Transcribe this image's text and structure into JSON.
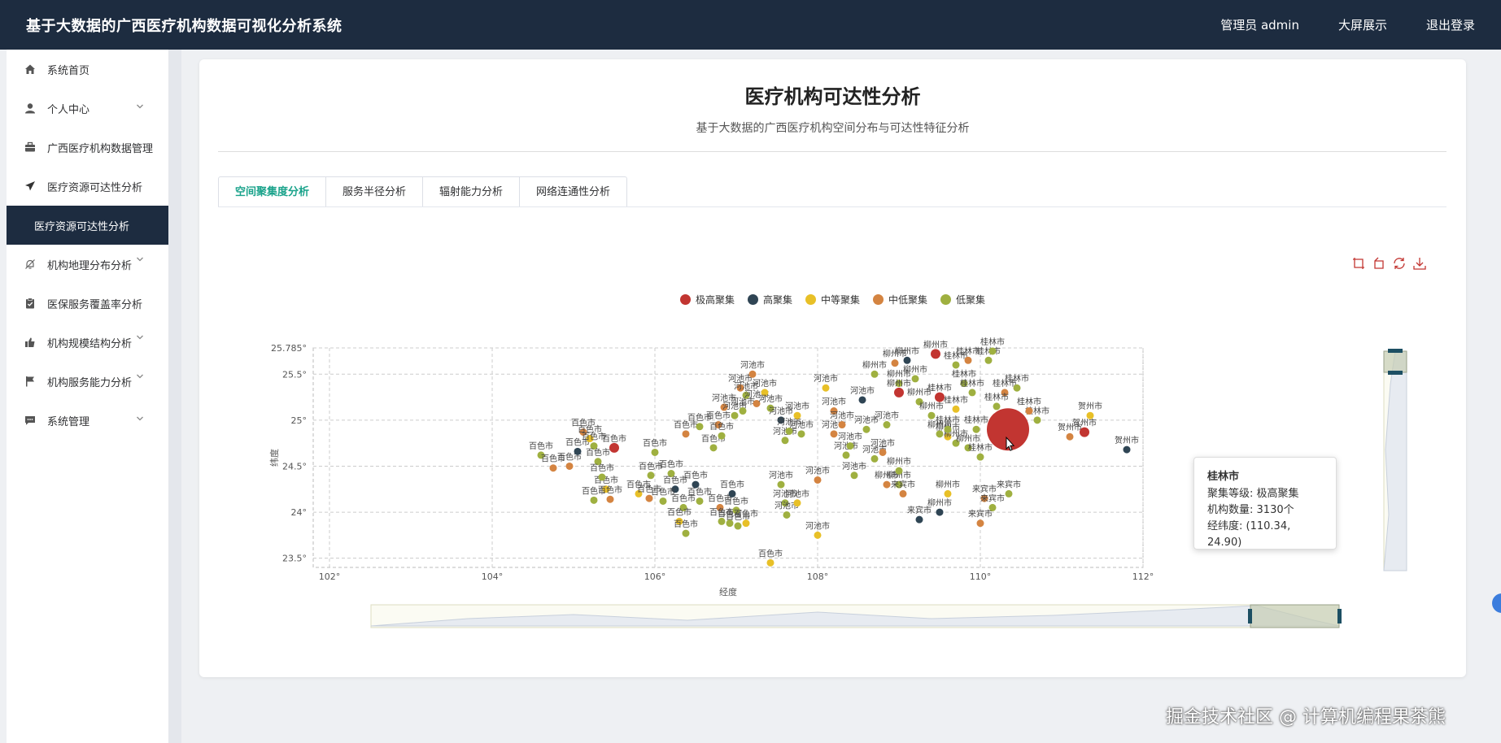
{
  "app": {
    "title": "基于大数据的广西医疗机构数据可视化分析系统",
    "user_label": "管理员 admin",
    "bigscreen_label": "大屏展示",
    "logout_label": "退出登录"
  },
  "sidebar": {
    "items": [
      {
        "label": "系统首页",
        "icon": "home-icon"
      },
      {
        "label": "个人中心",
        "icon": "user-icon",
        "expandable": true
      },
      {
        "label": "广西医疗机构数据管理",
        "icon": "briefcase-icon"
      },
      {
        "label": "医疗资源可达性分析",
        "icon": "send-icon"
      },
      {
        "label": "医疗资源可达性分析",
        "active": true
      },
      {
        "label": "机构地理分布分析",
        "icon": "bell-off-icon",
        "expandable": true
      },
      {
        "label": "医保服务覆盖率分析",
        "icon": "clipboard-icon"
      },
      {
        "label": "机构规模结构分析",
        "icon": "thumbs-up-icon",
        "expandable": true
      },
      {
        "label": "机构服务能力分析",
        "icon": "flag-icon",
        "expandable": true
      },
      {
        "label": "系统管理",
        "icon": "chat-icon",
        "expandable": true
      }
    ]
  },
  "page": {
    "title": "医疗机构可达性分析",
    "subtitle": "基于大数据的广西医疗机构空间分布与可达性特征分析"
  },
  "tabs": [
    {
      "label": "空间聚集度分析",
      "active": true
    },
    {
      "label": "服务半径分析"
    },
    {
      "label": "辐射能力分析"
    },
    {
      "label": "网络连通性分析"
    }
  ],
  "toolbox": [
    "zoom-icon",
    "zoom-reset-icon",
    "restore-icon",
    "download-icon"
  ],
  "chart_data": {
    "type": "scatter",
    "xlabel": "经度",
    "ylabel": "纬度",
    "xlim": [
      101.8,
      112
    ],
    "ylim": [
      23.4,
      25.785
    ],
    "xticks": [
      102,
      104,
      106,
      108,
      110,
      112
    ],
    "xtick_labels": [
      "102°",
      "104°",
      "106°",
      "108°",
      "110°",
      "112°"
    ],
    "yticks": [
      23.5,
      24,
      24.5,
      25,
      25.5,
      25.785
    ],
    "ytick_labels": [
      "23.5°",
      "24°",
      "24.5°",
      "25°",
      "25.5°",
      "25.785°"
    ],
    "grid": true,
    "legend_position": "top",
    "series": [
      {
        "name": "极高聚集",
        "color": "#c23531"
      },
      {
        "name": "高聚集",
        "color": "#2f4554"
      },
      {
        "name": "中等聚集",
        "color": "#e8c027"
      },
      {
        "name": "中低聚集",
        "color": "#d48441"
      },
      {
        "name": "低聚集",
        "color": "#9fb040"
      }
    ],
    "highlight": {
      "city": "桂林市",
      "level_label": "聚集等级:",
      "level": "极高聚集",
      "count_label": "机构数量:",
      "count": "3130个",
      "coord_label": "经纬度:",
      "coord": "(110.34, 24.90)",
      "lon": 110.34,
      "lat": 24.9
    },
    "points": [
      {
        "city": "百色市",
        "lon": 104.6,
        "lat": 24.62,
        "s": 4
      },
      {
        "city": "百色市",
        "lon": 104.75,
        "lat": 24.48,
        "s": 3
      },
      {
        "city": "百色市",
        "lon": 104.95,
        "lat": 24.5,
        "s": 3
      },
      {
        "city": "百色市",
        "lon": 105.05,
        "lat": 24.66,
        "s": 1
      },
      {
        "city": "百色市",
        "lon": 105.12,
        "lat": 24.87,
        "s": 3
      },
      {
        "city": "百色市",
        "lon": 105.2,
        "lat": 24.8,
        "s": 2
      },
      {
        "city": "百色市",
        "lon": 105.25,
        "lat": 24.72,
        "s": 4
      },
      {
        "city": "百色市",
        "lon": 105.3,
        "lat": 24.55,
        "s": 4
      },
      {
        "city": "百色市",
        "lon": 105.5,
        "lat": 24.7,
        "s": 0
      },
      {
        "city": "百色市",
        "lon": 105.25,
        "lat": 24.13,
        "s": 4
      },
      {
        "city": "百色市",
        "lon": 105.4,
        "lat": 24.25,
        "s": 2
      },
      {
        "city": "百色市",
        "lon": 105.45,
        "lat": 24.14,
        "s": 3
      },
      {
        "city": "百色市",
        "lon": 105.35,
        "lat": 24.38,
        "s": 4
      },
      {
        "city": "百色市",
        "lon": 105.8,
        "lat": 24.2,
        "s": 2
      },
      {
        "city": "百色市",
        "lon": 105.95,
        "lat": 24.4,
        "s": 4
      },
      {
        "city": "百色市",
        "lon": 105.93,
        "lat": 24.15,
        "s": 3
      },
      {
        "city": "百色市",
        "lon": 106.0,
        "lat": 24.65,
        "s": 4
      },
      {
        "city": "百色市",
        "lon": 106.2,
        "lat": 24.42,
        "s": 4
      },
      {
        "city": "百色市",
        "lon": 106.25,
        "lat": 24.25,
        "s": 1
      },
      {
        "city": "百色市",
        "lon": 106.35,
        "lat": 24.05,
        "s": 4
      },
      {
        "city": "百色市",
        "lon": 106.3,
        "lat": 23.9,
        "s": 2
      },
      {
        "city": "百色市",
        "lon": 106.38,
        "lat": 23.77,
        "s": 4
      },
      {
        "city": "百色市",
        "lon": 106.1,
        "lat": 24.12,
        "s": 4
      },
      {
        "city": "百色市",
        "lon": 106.5,
        "lat": 24.3,
        "s": 1
      },
      {
        "city": "百色市",
        "lon": 106.55,
        "lat": 24.12,
        "s": 4
      },
      {
        "city": "百色市",
        "lon": 106.38,
        "lat": 24.85,
        "s": 3
      },
      {
        "city": "百色市",
        "lon": 106.55,
        "lat": 24.93,
        "s": 4
      },
      {
        "city": "百色市",
        "lon": 106.72,
        "lat": 24.7,
        "s": 4
      },
      {
        "city": "百色市",
        "lon": 106.78,
        "lat": 24.95,
        "s": 3
      },
      {
        "city": "百色市",
        "lon": 106.82,
        "lat": 24.83,
        "s": 4
      },
      {
        "city": "百色市",
        "lon": 106.8,
        "lat": 24.05,
        "s": 3
      },
      {
        "city": "百色市",
        "lon": 106.82,
        "lat": 23.9,
        "s": 4
      },
      {
        "city": "百色市",
        "lon": 106.92,
        "lat": 23.88,
        "s": 4
      },
      {
        "city": "百色市",
        "lon": 107.0,
        "lat": 24.02,
        "s": 4
      },
      {
        "city": "百色市",
        "lon": 107.02,
        "lat": 23.85,
        "s": 4
      },
      {
        "city": "百色市",
        "lon": 107.12,
        "lat": 23.88,
        "s": 2
      },
      {
        "city": "百色市",
        "lon": 107.42,
        "lat": 23.45,
        "s": 2
      },
      {
        "city": "百色市",
        "lon": 106.95,
        "lat": 24.2,
        "s": 1
      },
      {
        "city": "河池市",
        "lon": 106.85,
        "lat": 25.14,
        "s": 3
      },
      {
        "city": "河池市",
        "lon": 106.98,
        "lat": 25.05,
        "s": 4
      },
      {
        "city": "河池市",
        "lon": 107.05,
        "lat": 25.35,
        "s": 3
      },
      {
        "city": "河池市",
        "lon": 107.12,
        "lat": 25.27,
        "s": 4
      },
      {
        "city": "河池市",
        "lon": 107.08,
        "lat": 25.1,
        "s": 4
      },
      {
        "city": "河池市",
        "lon": 107.2,
        "lat": 25.5,
        "s": 3
      },
      {
        "city": "河池市",
        "lon": 107.25,
        "lat": 25.18,
        "s": 3
      },
      {
        "city": "河池市",
        "lon": 107.35,
        "lat": 25.3,
        "s": 2
      },
      {
        "city": "河池市",
        "lon": 107.42,
        "lat": 25.13,
        "s": 4
      },
      {
        "city": "河池市",
        "lon": 107.55,
        "lat": 25.0,
        "s": 1
      },
      {
        "city": "河池市",
        "lon": 107.6,
        "lat": 24.78,
        "s": 4
      },
      {
        "city": "河池市",
        "lon": 107.65,
        "lat": 24.88,
        "s": 4
      },
      {
        "city": "河池市",
        "lon": 107.75,
        "lat": 25.05,
        "s": 2
      },
      {
        "city": "河池市",
        "lon": 107.8,
        "lat": 24.85,
        "s": 4
      },
      {
        "city": "河池市",
        "lon": 107.55,
        "lat": 24.3,
        "s": 4
      },
      {
        "city": "河池市",
        "lon": 107.6,
        "lat": 24.1,
        "s": 4
      },
      {
        "city": "河池市",
        "lon": 107.62,
        "lat": 23.97,
        "s": 4
      },
      {
        "city": "河池市",
        "lon": 107.75,
        "lat": 24.1,
        "s": 2
      },
      {
        "city": "河池市",
        "lon": 108.0,
        "lat": 23.75,
        "s": 2
      },
      {
        "city": "河池市",
        "lon": 108.0,
        "lat": 24.35,
        "s": 3
      },
      {
        "city": "河池市",
        "lon": 108.1,
        "lat": 25.35,
        "s": 2
      },
      {
        "city": "河池市",
        "lon": 108.2,
        "lat": 25.1,
        "s": 3
      },
      {
        "city": "河池市",
        "lon": 108.2,
        "lat": 24.85,
        "s": 3
      },
      {
        "city": "河池市",
        "lon": 108.3,
        "lat": 24.95,
        "s": 3
      },
      {
        "city": "河池市",
        "lon": 108.35,
        "lat": 24.62,
        "s": 4
      },
      {
        "city": "河池市",
        "lon": 108.4,
        "lat": 24.72,
        "s": 4
      },
      {
        "city": "河池市",
        "lon": 108.45,
        "lat": 24.4,
        "s": 4
      },
      {
        "city": "河池市",
        "lon": 108.55,
        "lat": 25.22,
        "s": 1
      },
      {
        "city": "河池市",
        "lon": 108.6,
        "lat": 24.9,
        "s": 4
      },
      {
        "city": "河池市",
        "lon": 108.7,
        "lat": 24.58,
        "s": 4
      },
      {
        "city": "河池市",
        "lon": 108.8,
        "lat": 24.65,
        "s": 3
      },
      {
        "city": "河池市",
        "lon": 108.85,
        "lat": 24.95,
        "s": 4
      },
      {
        "city": "柳州市",
        "lon": 108.7,
        "lat": 25.5,
        "s": 4
      },
      {
        "city": "柳州市",
        "lon": 108.95,
        "lat": 25.62,
        "s": 3
      },
      {
        "city": "柳州市",
        "lon": 109.1,
        "lat": 25.65,
        "s": 1
      },
      {
        "city": "柳州市",
        "lon": 109.0,
        "lat": 25.4,
        "s": 4
      },
      {
        "city": "柳州市",
        "lon": 109.2,
        "lat": 25.45,
        "s": 4
      },
      {
        "city": "柳州市",
        "lon": 109.25,
        "lat": 25.2,
        "s": 4
      },
      {
        "city": "柳州市",
        "lon": 109.45,
        "lat": 25.72,
        "s": 0
      },
      {
        "city": "柳州市",
        "lon": 109.0,
        "lat": 25.3,
        "s": 0
      },
      {
        "city": "柳州市",
        "lon": 109.4,
        "lat": 25.05,
        "s": 4
      },
      {
        "city": "柳州市",
        "lon": 109.5,
        "lat": 24.85,
        "s": 4
      },
      {
        "city": "柳州市",
        "lon": 109.6,
        "lat": 24.82,
        "s": 2
      },
      {
        "city": "柳州市",
        "lon": 109.7,
        "lat": 24.75,
        "s": 4
      },
      {
        "city": "柳州市",
        "lon": 109.85,
        "lat": 24.7,
        "s": 4
      },
      {
        "city": "柳州市",
        "lon": 109.0,
        "lat": 24.3,
        "s": 4
      },
      {
        "city": "柳州市",
        "lon": 108.85,
        "lat": 24.3,
        "s": 3
      },
      {
        "city": "柳州市",
        "lon": 109.0,
        "lat": 24.45,
        "s": 4
      },
      {
        "city": "柳州市",
        "lon": 109.6,
        "lat": 24.2,
        "s": 2
      },
      {
        "city": "柳州市",
        "lon": 109.5,
        "lat": 24.0,
        "s": 1
      },
      {
        "city": "桂林市",
        "lon": 109.7,
        "lat": 25.6,
        "s": 4
      },
      {
        "city": "桂林市",
        "lon": 109.85,
        "lat": 25.65,
        "s": 3
      },
      {
        "city": "桂林市",
        "lon": 110.1,
        "lat": 25.65,
        "s": 4
      },
      {
        "city": "桂林市",
        "lon": 110.15,
        "lat": 25.75,
        "s": 4
      },
      {
        "city": "桂林市",
        "lon": 109.8,
        "lat": 25.4,
        "s": 4
      },
      {
        "city": "桂林市",
        "lon": 109.9,
        "lat": 25.3,
        "s": 4
      },
      {
        "city": "桂林市",
        "lon": 109.5,
        "lat": 25.25,
        "s": 0
      },
      {
        "city": "桂林市",
        "lon": 110.3,
        "lat": 25.3,
        "s": 3
      },
      {
        "city": "桂林市",
        "lon": 110.45,
        "lat": 25.35,
        "s": 4
      },
      {
        "city": "桂林市",
        "lon": 110.2,
        "lat": 25.15,
        "s": 4
      },
      {
        "city": "桂林市",
        "lon": 110.7,
        "lat": 25.0,
        "s": 4
      },
      {
        "city": "桂林市",
        "lon": 110.6,
        "lat": 25.1,
        "s": 3
      },
      {
        "city": "桂林市",
        "lon": 109.7,
        "lat": 25.12,
        "s": 2
      },
      {
        "city": "桂林市",
        "lon": 109.95,
        "lat": 24.9,
        "s": 4
      },
      {
        "city": "桂林市",
        "lon": 110.0,
        "lat": 24.6,
        "s": 4
      },
      {
        "city": "桂林市",
        "lon": 109.6,
        "lat": 24.9,
        "s": 4
      },
      {
        "city": "来宾市",
        "lon": 109.05,
        "lat": 24.2,
        "s": 3
      },
      {
        "city": "来宾市",
        "lon": 109.25,
        "lat": 23.92,
        "s": 1
      },
      {
        "city": "来宾市",
        "lon": 110.05,
        "lat": 24.15,
        "s": 3
      },
      {
        "city": "来宾市",
        "lon": 110.35,
        "lat": 24.2,
        "s": 4
      },
      {
        "city": "来宾市",
        "lon": 110.0,
        "lat": 23.88,
        "s": 3
      },
      {
        "city": "来宾市",
        "lon": 110.15,
        "lat": 24.05,
        "s": 4
      },
      {
        "city": "贺州市",
        "lon": 111.1,
        "lat": 24.82,
        "s": 3
      },
      {
        "city": "贺州市",
        "lon": 111.28,
        "lat": 24.87,
        "s": 0
      },
      {
        "city": "贺州市",
        "lon": 111.35,
        "lat": 25.05,
        "s": 2
      },
      {
        "city": "贺州市",
        "lon": 111.8,
        "lat": 24.68,
        "s": 1
      }
    ]
  },
  "watermark": "掘金技术社区 @ 计算机编程果茶熊"
}
